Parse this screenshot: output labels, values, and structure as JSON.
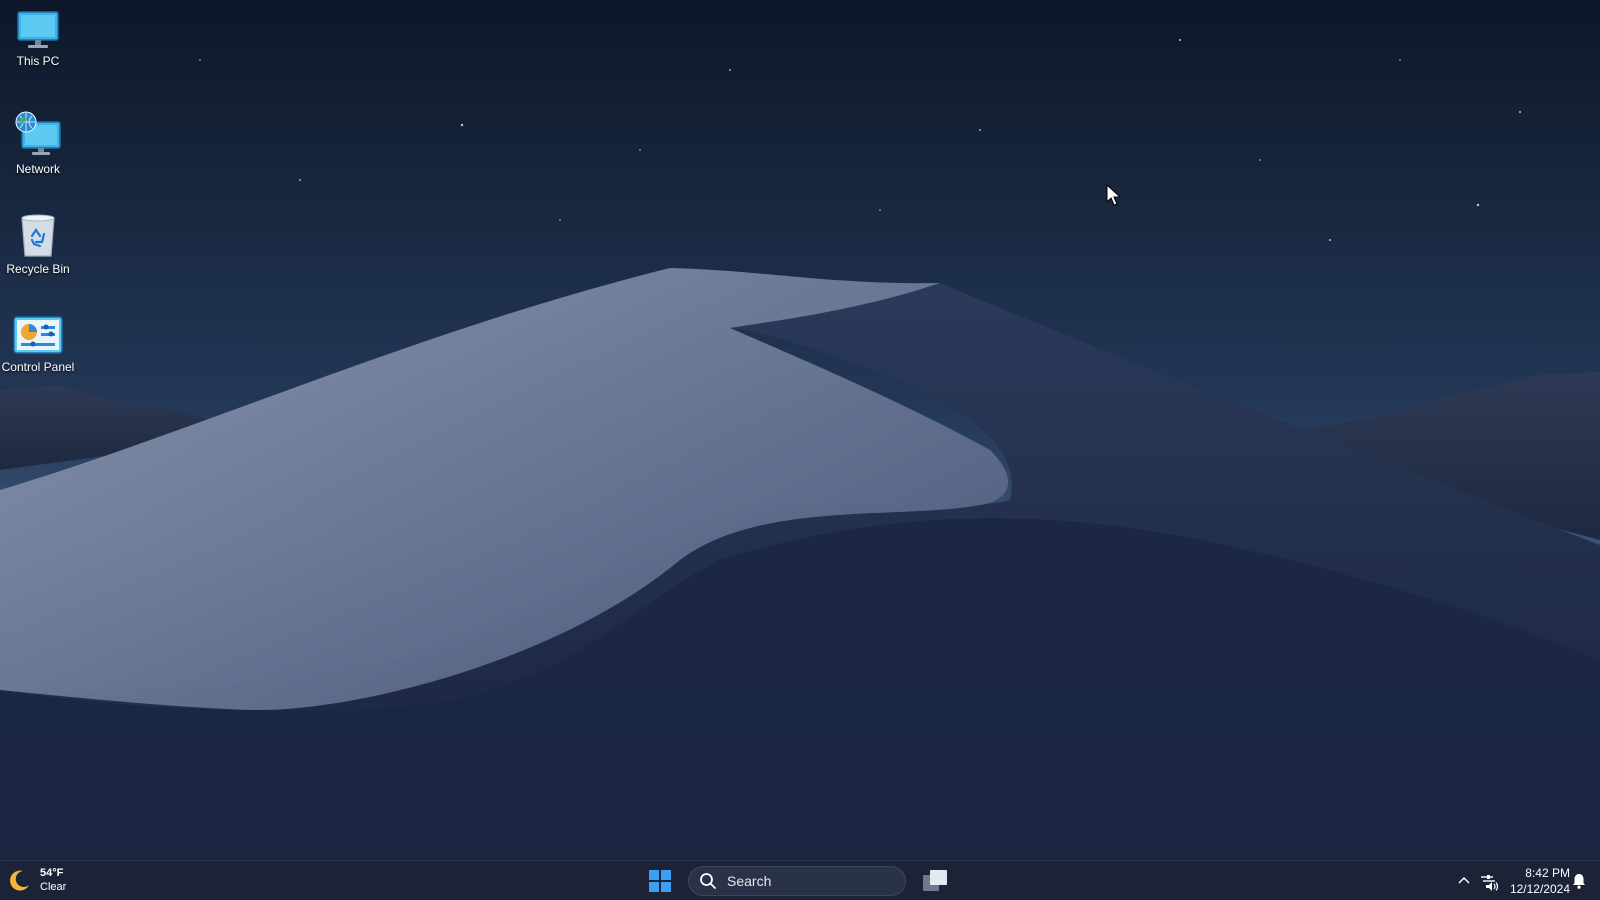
{
  "desktop": {
    "icons": [
      {
        "label": "This PC",
        "icon": "monitor-icon"
      },
      {
        "label": "Network",
        "icon": "network-globe-icon"
      },
      {
        "label": "Recycle Bin",
        "icon": "recycle-bin-icon"
      },
      {
        "label": "Control Panel",
        "icon": "control-panel-icon"
      }
    ]
  },
  "taskbar": {
    "weather": {
      "temperature": "54°F",
      "condition": "Clear",
      "icon": "moon-icon"
    },
    "start_icon": "windows-start-icon",
    "search": {
      "placeholder": "Search",
      "icon": "search-icon"
    },
    "task_view_icon": "task-view-icon",
    "tray": {
      "chevron_icon": "chevron-up-icon",
      "network_icon": "network-icon",
      "volume_icon": "volume-icon",
      "notification_icon": "bell-icon"
    },
    "clock": {
      "time": "8:42 PM",
      "date": "12/12/2024"
    }
  },
  "colors": {
    "taskbar_bg": "#1c2336",
    "accent": "#1e90ff"
  }
}
